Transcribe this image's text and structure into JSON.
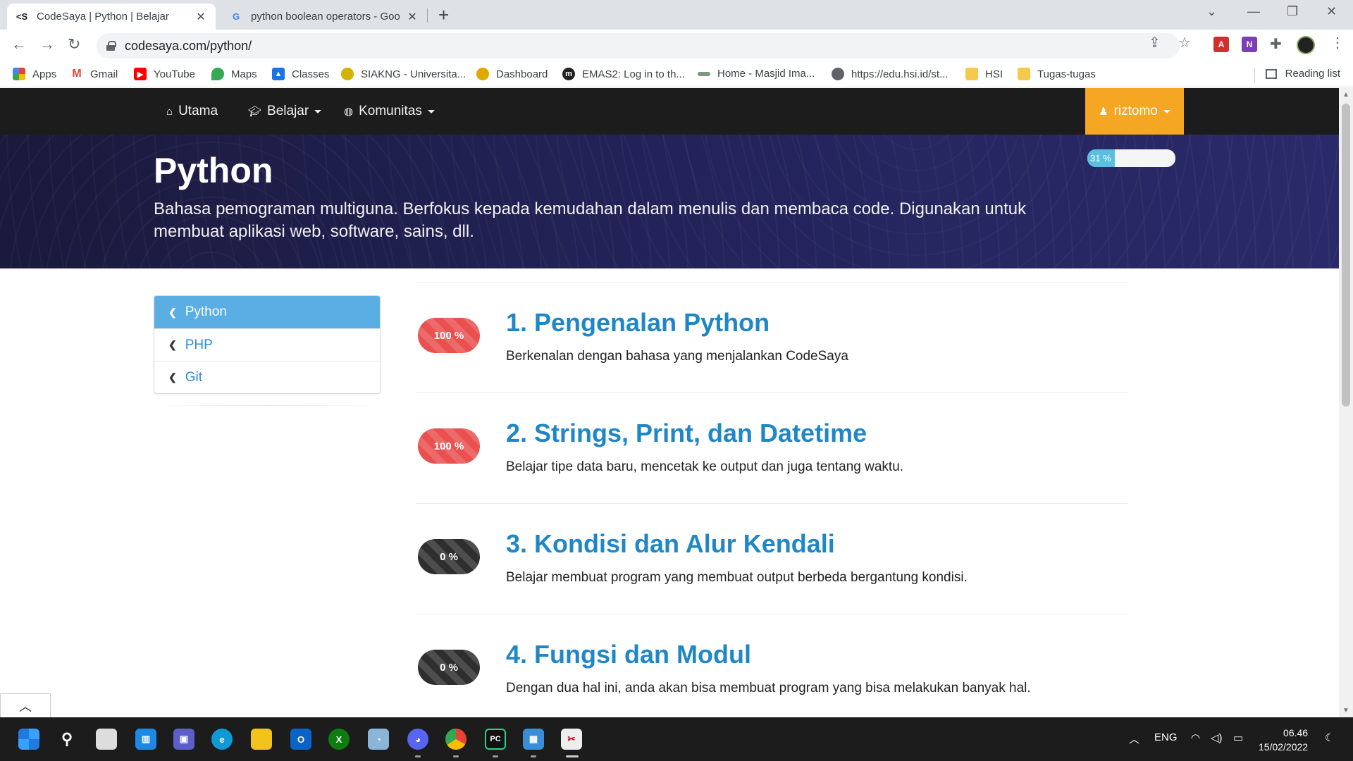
{
  "browser": {
    "tabs": [
      {
        "title": "CodeSaya | Python | Belajar",
        "favicon": "<S",
        "active": true
      },
      {
        "title": "python boolean operators - Goo",
        "favicon": "G",
        "active": false
      }
    ],
    "url": "codesaya.com/python/",
    "bookmarks": [
      {
        "label": "Apps",
        "icon": "apps-grid-icon",
        "color": "#ea4335"
      },
      {
        "label": "Gmail",
        "icon": "gmail-icon",
        "color": "#ea4335"
      },
      {
        "label": "YouTube",
        "icon": "youtube-icon",
        "color": "#ff0000"
      },
      {
        "label": "Maps",
        "icon": "maps-icon",
        "color": "#34a853"
      },
      {
        "label": "Classes",
        "icon": "classes-icon",
        "color": "#1a73e8"
      },
      {
        "label": "SIAKNG - Universita...",
        "icon": "siakng-icon",
        "color": "#d4b200"
      },
      {
        "label": "Dashboard",
        "icon": "dashboard-icon",
        "color": "#e0a800"
      },
      {
        "label": "EMAS2: Log in to th...",
        "icon": "emas-icon",
        "color": "#222222"
      },
      {
        "label": "Home - Masjid Ima...",
        "icon": "masjid-icon",
        "color": "#7a9a7a"
      },
      {
        "label": "https://edu.hsi.id/st...",
        "icon": "globe-icon",
        "color": "#5f6368"
      },
      {
        "label": "HSI",
        "icon": "folder-icon",
        "color": "#f6c94a"
      },
      {
        "label": "Tugas-tugas",
        "icon": "folder-icon",
        "color": "#f6c94a"
      }
    ],
    "reading_list": "Reading list"
  },
  "site": {
    "nav": {
      "home": "Utama",
      "learn": "Belajar",
      "community": "Komunitas",
      "user": "riztomo"
    },
    "hero": {
      "title": "Python",
      "description": "Bahasa pemograman multiguna. Berfokus kepada kemudahan dalam menulis dan membaca code. Digunakan untuk membuat aplikasi web, software, sains, dll.",
      "progress_label": "31 %",
      "progress_value": 31
    },
    "sidebar": [
      {
        "label": "Python",
        "active": true
      },
      {
        "label": "PHP",
        "active": false
      },
      {
        "label": "Git",
        "active": false
      }
    ],
    "lessons": [
      {
        "badge": "100 %",
        "title": "1. Pengenalan Python",
        "desc": "Berkenalan dengan bahasa yang menjalankan CodeSaya",
        "done": true
      },
      {
        "badge": "100 %",
        "title": "2. Strings, Print, dan Datetime",
        "desc": "Belajar tipe data baru, mencetak ke output dan juga tentang waktu.",
        "done": true
      },
      {
        "badge": "0 %",
        "title": "3. Kondisi dan Alur Kendali",
        "desc": "Belajar membuat program yang membuat output berbeda bergantung kondisi.",
        "done": false
      },
      {
        "badge": "0 %",
        "title": "4. Fungsi dan Modul",
        "desc": "Dengan dua hal ini, anda akan bisa membuat program yang bisa melakukan banyak hal.",
        "done": false
      }
    ]
  },
  "taskbar": {
    "language": "ENG",
    "time": "06.46",
    "date": "15/02/2022"
  },
  "colors": {
    "accent_blue": "#1f87c7",
    "user_orange": "#f5a623",
    "done_red": "#e9504f",
    "todo_dark": "#2e2e2e",
    "progress_cyan": "#5bc0de"
  }
}
